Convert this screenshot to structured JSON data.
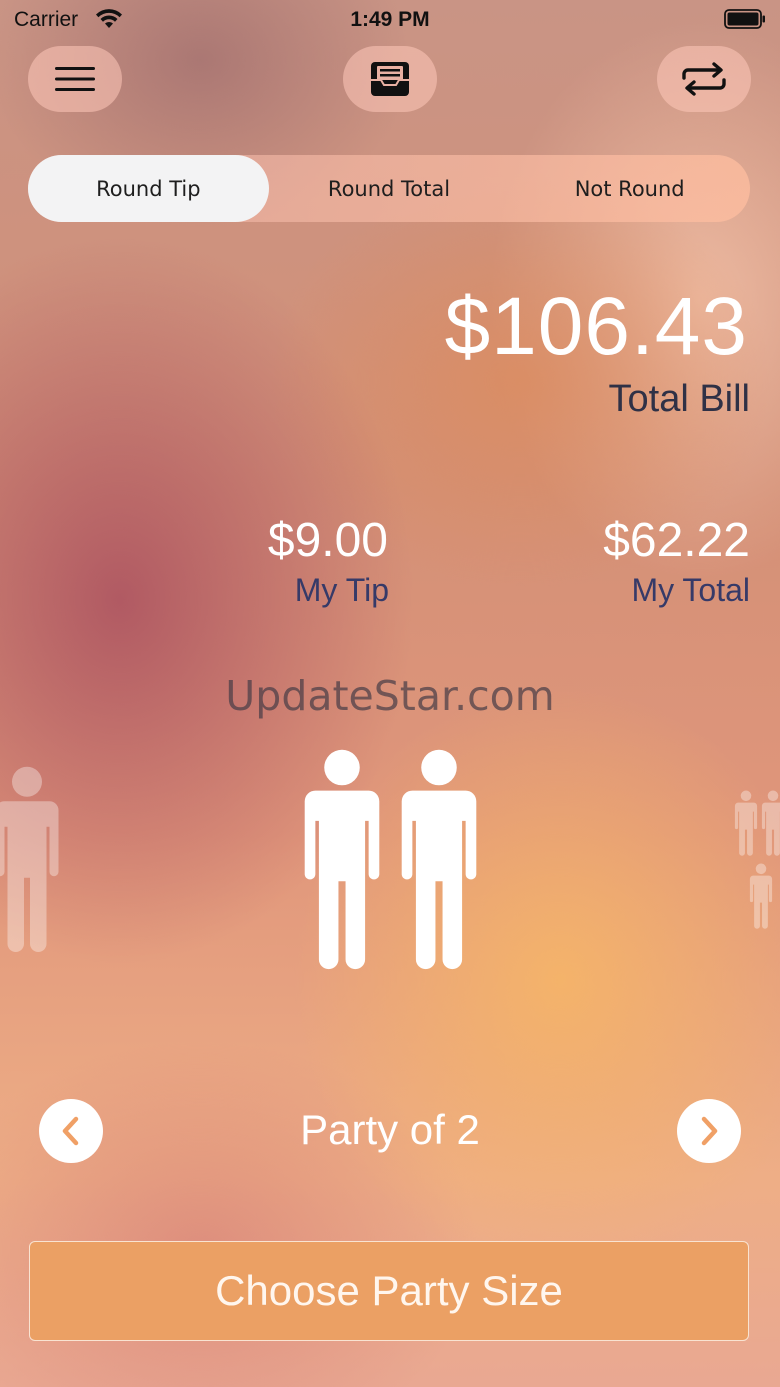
{
  "status_bar": {
    "carrier": "Carrier",
    "time": "1:49 PM",
    "icons": [
      "wifi-icon",
      "battery-icon"
    ]
  },
  "toolbar": {
    "menu_icon": "hamburger-menu-icon",
    "receipt_icon": "receipt-tray-icon",
    "swap_icon": "swap-arrows-icon"
  },
  "rounding": {
    "options": [
      "Round Tip",
      "Round Total",
      "Not Round"
    ],
    "selected": "Round Tip"
  },
  "summary": {
    "total_bill": "$106.43",
    "total_bill_label": "Total Bill",
    "my_tip": "$9.00",
    "my_tip_label": "My Tip",
    "my_total": "$62.22",
    "my_total_label": "My Total"
  },
  "watermark": "UpdateStar.com",
  "party": {
    "label": "Party of 2",
    "size": 2,
    "prev_icon": "chevron-left-icon",
    "next_icon": "chevron-right-icon"
  },
  "choose_button": {
    "label": "Choose Party Size"
  },
  "colors": {
    "accent_button": "#eba064",
    "label_dark": "#363a68",
    "chevron": "#f0a066"
  }
}
